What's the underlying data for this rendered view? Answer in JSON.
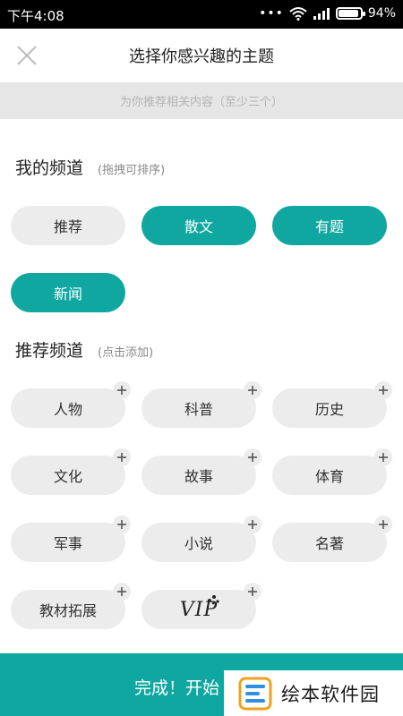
{
  "status_bar": {
    "time": "下午4:08",
    "dots": "•••",
    "battery_text": "94%",
    "battery_level": 0.94
  },
  "header": {
    "title": "选择你感兴趣的主题",
    "close_icon": "close-icon"
  },
  "subtitle": "为你推荐相关内容（至少三个）",
  "my_channels": {
    "title": "我的频道",
    "hint": "(拖拽可排序)",
    "items": [
      {
        "label": "推荐",
        "selected": false
      },
      {
        "label": "散文",
        "selected": true
      },
      {
        "label": "有题",
        "selected": true
      },
      {
        "label": "新闻",
        "selected": true
      }
    ]
  },
  "recommended_channels": {
    "title": "推荐频道",
    "hint": "(点击添加)",
    "items": [
      {
        "label": "人物"
      },
      {
        "label": "科普"
      },
      {
        "label": "历史"
      },
      {
        "label": "文化"
      },
      {
        "label": "故事"
      },
      {
        "label": "体育"
      },
      {
        "label": "军事"
      },
      {
        "label": "小说"
      },
      {
        "label": "名著"
      },
      {
        "label": "教材拓展"
      },
      {
        "label": "VIP"
      }
    ]
  },
  "bottom_button": {
    "label": "完成！开始"
  },
  "watermark": {
    "text": "绘本软件园"
  },
  "colors": {
    "accent": "#0fa7a0",
    "chip_gray": "#ececec",
    "subtitle_bg": "#e6e6e6"
  }
}
